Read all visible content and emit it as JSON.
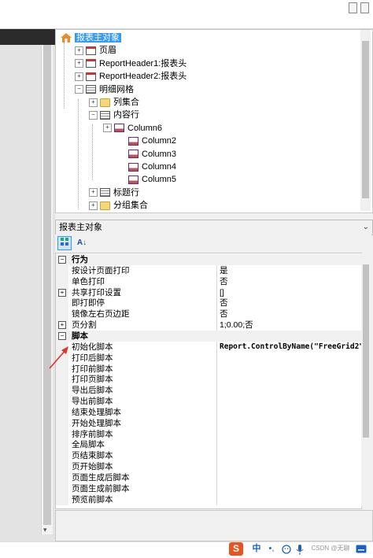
{
  "tree": {
    "nodes": [
      {
        "label": "报表主对象",
        "icon": "home-icon",
        "expander": "",
        "selected": true
      },
      {
        "label": "页眉",
        "icon": "page-icon",
        "expander": "+"
      },
      {
        "label": "ReportHeader1:报表头",
        "icon": "page-icon",
        "expander": "+"
      },
      {
        "label": "ReportHeader2:报表头",
        "icon": "page-icon",
        "expander": "+"
      },
      {
        "label": "明细网格",
        "icon": "grid-icon",
        "expander": "−"
      },
      {
        "label": "列集合",
        "icon": "folder-icon",
        "expander": "+"
      },
      {
        "label": "内容行",
        "icon": "grid-icon",
        "expander": "−"
      },
      {
        "label": "Column6",
        "icon": "column-icon",
        "expander": "+"
      },
      {
        "label": "Column2",
        "icon": "column-icon",
        "expander": ""
      },
      {
        "label": "Column3",
        "icon": "column-icon",
        "expander": ""
      },
      {
        "label": "Column4",
        "icon": "column-icon",
        "expander": ""
      },
      {
        "label": "Column5",
        "icon": "column-icon",
        "expander": ""
      },
      {
        "label": "标题行",
        "icon": "grid-icon",
        "expander": "+"
      },
      {
        "label": "分组集合",
        "icon": "folder-icon",
        "expander": "+"
      }
    ]
  },
  "props": {
    "object_name": "报表主对象",
    "dropdown_glyph": "⌄",
    "sort_glyph": "A↓",
    "rows": [
      {
        "type": "cat",
        "name": "行为",
        "expander": "−"
      },
      {
        "name": "按设计页面打印",
        "value": "是"
      },
      {
        "name": "单色打印",
        "value": "否"
      },
      {
        "name": "共享打印设置",
        "value": "[]",
        "expander": "+"
      },
      {
        "name": "即打即停",
        "value": "否"
      },
      {
        "name": "镜像左右页边距",
        "value": "否"
      },
      {
        "name": "页分割",
        "value": "1;0.00;否",
        "expander": "+"
      },
      {
        "type": "cat",
        "name": "脚本",
        "expander": "−"
      },
      {
        "name": "初始化脚本",
        "value": "Report.ControlByName(\"FreeGrid2\"",
        "mono": true
      },
      {
        "name": "打印后脚本",
        "value": ""
      },
      {
        "name": "打印前脚本",
        "value": ""
      },
      {
        "name": "打印页脚本",
        "value": ""
      },
      {
        "name": "导出后脚本",
        "value": ""
      },
      {
        "name": "导出前脚本",
        "value": ""
      },
      {
        "name": "结束处理脚本",
        "value": ""
      },
      {
        "name": "开始处理脚本",
        "value": ""
      },
      {
        "name": "排序前脚本",
        "value": ""
      },
      {
        "name": "全局脚本",
        "value": ""
      },
      {
        "name": "页结束脚本",
        "value": ""
      },
      {
        "name": "页开始脚本",
        "value": ""
      },
      {
        "name": "页面生成后脚本",
        "value": ""
      },
      {
        "name": "页面生成前脚本",
        "value": ""
      },
      {
        "name": "预览前脚本",
        "value": ""
      }
    ]
  },
  "taskbar": {
    "ime_logo": "S",
    "ime_lang": "中",
    "punct": "•,",
    "watermark": "CSDN @无聊"
  },
  "colors": {
    "selection": "#3399ff",
    "annotation_arrow": "#e0312b",
    "ime_brand": "#e8531e"
  }
}
